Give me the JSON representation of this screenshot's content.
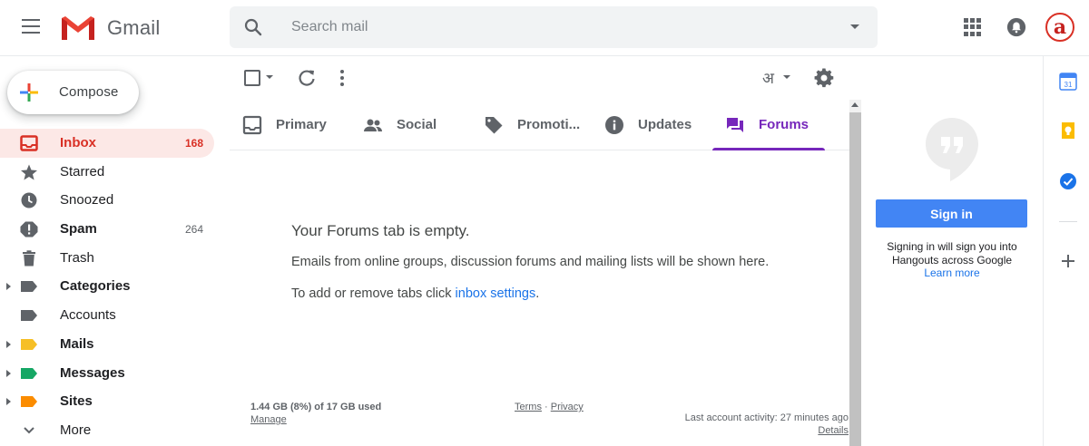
{
  "header": {
    "app_name": "Gmail",
    "search_placeholder": "Search mail",
    "avatar_letter": "a",
    "icons": [
      "menu-icon",
      "gmail-logo-icon",
      "search-icon",
      "search-options-icon",
      "apps-icon",
      "notifications-icon"
    ]
  },
  "compose": {
    "label": "Compose"
  },
  "nav": {
    "items": [
      {
        "label": "Inbox",
        "count": "168",
        "icon": "inbox-icon",
        "active": true
      },
      {
        "label": "Starred",
        "count": "",
        "icon": "star-icon"
      },
      {
        "label": "Snoozed",
        "count": "",
        "icon": "clock-icon"
      },
      {
        "label": "Spam",
        "count": "264",
        "icon": "spam-icon"
      },
      {
        "label": "Trash",
        "count": "",
        "icon": "trash-icon"
      },
      {
        "label": "Categories",
        "count": "",
        "icon": "label-icon"
      },
      {
        "label": "Accounts",
        "count": "",
        "icon": "label-icon"
      },
      {
        "label": "Mails",
        "count": "",
        "icon": "label-icon",
        "color": "#f6bf26"
      },
      {
        "label": "Messages",
        "count": "",
        "icon": "label-icon",
        "color": "#16a765"
      },
      {
        "label": "Sites",
        "count": "",
        "icon": "label-icon",
        "color": "#fb8c00"
      },
      {
        "label": "More",
        "count": "",
        "icon": "chevron-down-icon"
      }
    ]
  },
  "toolbar": {
    "language": "अ",
    "icons": [
      "select-checkbox-icon",
      "refresh-icon",
      "more-vert-icon",
      "input-tools-icon",
      "settings-icon"
    ]
  },
  "tabs": [
    {
      "label": "Primary",
      "icon": "inbox-tab-icon"
    },
    {
      "label": "Social",
      "icon": "people-icon"
    },
    {
      "label": "Promoti...",
      "icon": "tag-icon"
    },
    {
      "label": "Updates",
      "icon": "info-icon"
    },
    {
      "label": "Forums",
      "icon": "forum-icon",
      "active": true
    }
  ],
  "main": {
    "empty_title": "Your Forums tab is empty.",
    "empty_desc": "Emails from online groups, discussion forums and mailing lists will be shown here.",
    "empty_tabs_prefix": "To add or remove tabs click ",
    "empty_tabs_link": "inbox settings",
    "empty_tabs_suffix": "."
  },
  "footer": {
    "storage": "1.44 GB (8%) of 17 GB used",
    "manage": "Manage",
    "terms": "Terms",
    "separator": " · ",
    "privacy": "Privacy",
    "activity": "Last account activity: 27 minutes ago",
    "details": "Details"
  },
  "hangouts": {
    "signin_label": "Sign in",
    "text_line1": "Signing in will sign you into",
    "text_line2": "Hangouts across Google",
    "learn_more": "Learn more"
  },
  "side_panel": {
    "icons": [
      "calendar-icon",
      "keep-icon",
      "tasks-icon",
      "add-addon-icon"
    ],
    "calendar_day": "31"
  },
  "colors": {
    "accent_red": "#d93025",
    "active_bg": "#fce8e6",
    "forums_purple": "#7627bb",
    "signin_blue": "#4285f4"
  }
}
